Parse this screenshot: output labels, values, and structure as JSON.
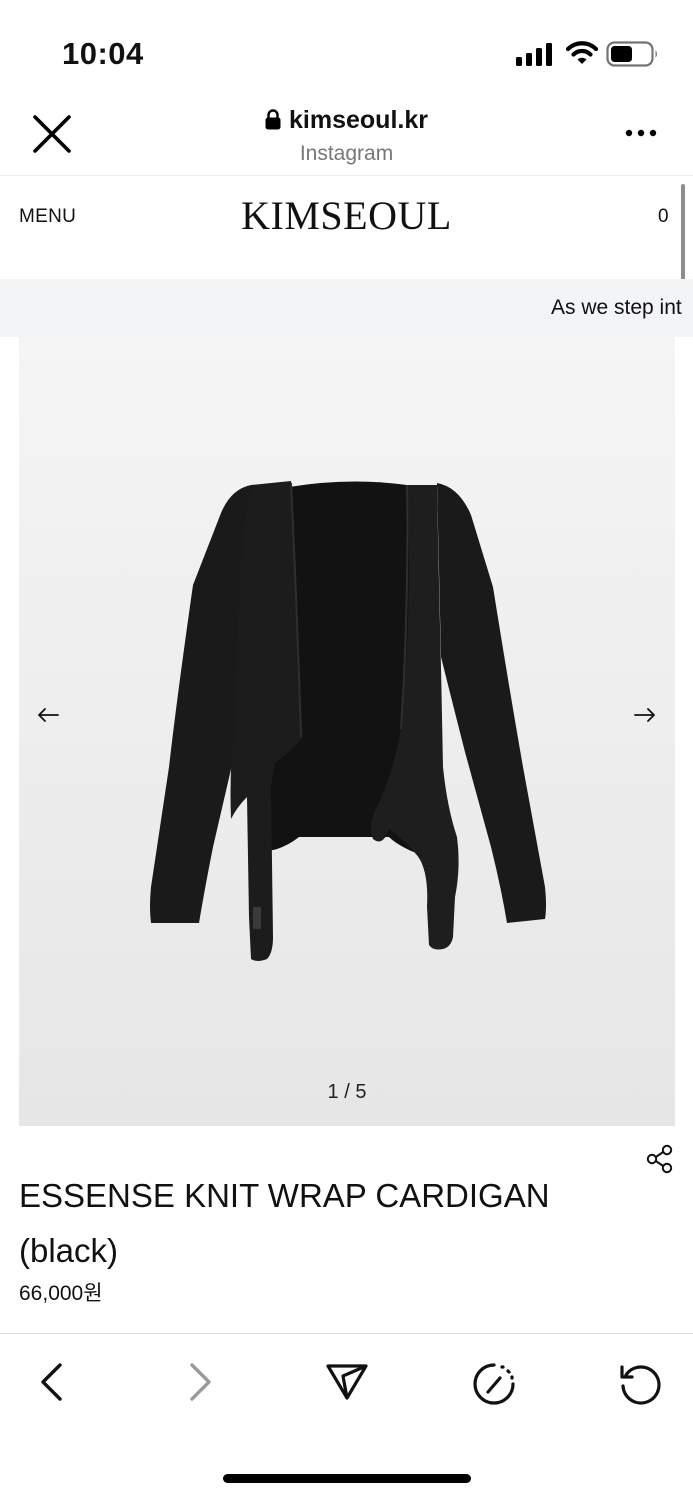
{
  "status_bar": {
    "time": "10:04"
  },
  "browser": {
    "url": "kimseoul.kr",
    "source": "Instagram"
  },
  "site": {
    "menu_label": "MENU",
    "brand": "KIMSEOUL",
    "cart_count": "0",
    "marquee_text": "As we step int"
  },
  "gallery": {
    "counter": "1 / 5",
    "current_slide": 1,
    "total_slides": 5,
    "prev_arrow": "←",
    "next_arrow": "→"
  },
  "product": {
    "title": "ESSENSE KNIT WRAP CARDIGAN (black)",
    "price": "66,000원"
  },
  "icons": {
    "status": [
      "signal-icon",
      "wifi-icon",
      "battery-icon"
    ],
    "header": [
      "close-icon",
      "lock-icon",
      "more-icon"
    ],
    "toolbar": [
      "back-icon",
      "forward-icon",
      "share-send-icon",
      "speed-icon",
      "reload-icon"
    ]
  },
  "colors": {
    "text": "#111111",
    "muted": "#777777",
    "banner_bg": "#f3f4f6",
    "garment": "#1a1a1a"
  }
}
